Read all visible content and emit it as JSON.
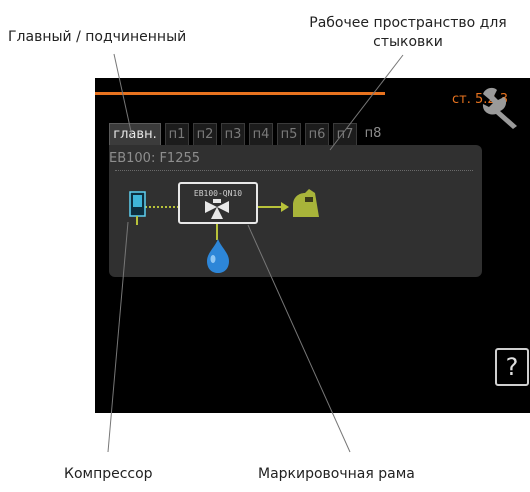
{
  "callouts": {
    "main_secondary": "Главный / подчиненный",
    "docking_workspace_line1": "Рабочее пространство для",
    "docking_workspace_line2": "стыковки",
    "compressor": "Компрессор",
    "marking_frame": "Маркировочная рама"
  },
  "screen": {
    "page_number": "ст. 5.2.3",
    "tabs": [
      "главн.",
      "п1",
      "п2",
      "п3",
      "п4",
      "п5",
      "п6",
      "п7",
      "п8"
    ],
    "active_tab": "главн.",
    "unit_label": "EB100: F1255",
    "component_label": "EB100-QN10",
    "help_symbol": "?"
  },
  "colors": {
    "accent": "#e8731f",
    "screen_bg": "#000000",
    "panel_bg": "#303030",
    "pipe": "#b8c23a",
    "water": "#2d86d8",
    "tank": "#a8b43a"
  },
  "icons": [
    "compressor-icon",
    "valve-icon",
    "water-drop-icon",
    "tank-icon",
    "wrench-icon",
    "help-icon"
  ]
}
